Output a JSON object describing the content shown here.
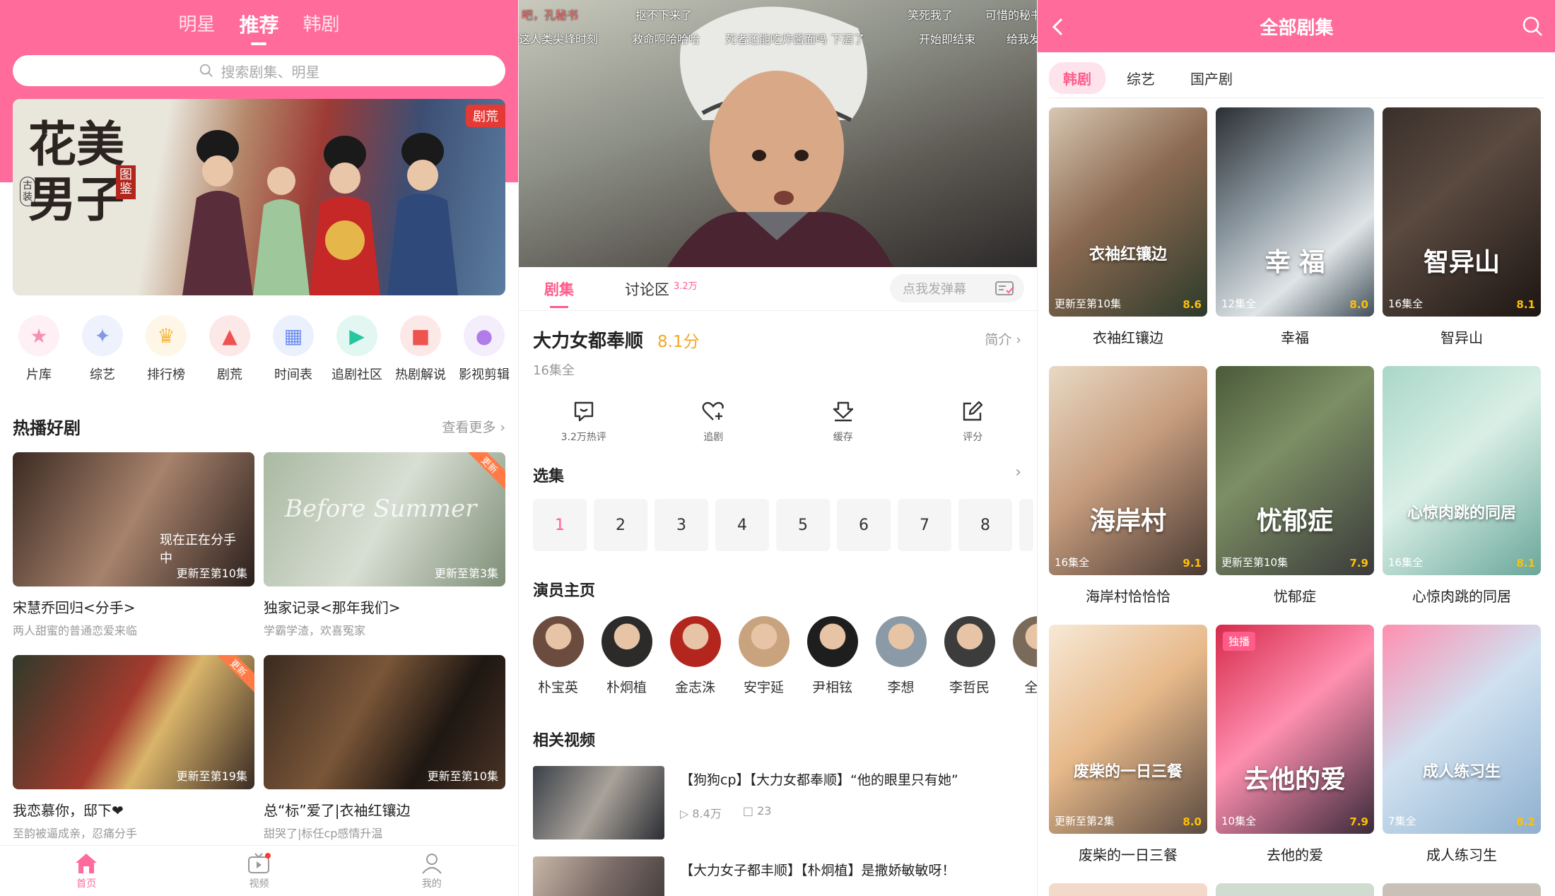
{
  "home": {
    "tabs": [
      "明星",
      "推荐",
      "韩剧"
    ],
    "active_tab": "推荐",
    "search_placeholder": "搜索剧集、明星",
    "banner": {
      "title": "花美男子",
      "tag_left": "古装",
      "tag_right": "图鉴",
      "badge": "剧荒"
    },
    "categories": [
      {
        "label": "片库",
        "icon": "library-icon",
        "color": "#f48fb1"
      },
      {
        "label": "综艺",
        "icon": "variety-icon",
        "color": "#7e9ce6"
      },
      {
        "label": "排行榜",
        "icon": "trophy-icon",
        "color": "#f5b942"
      },
      {
        "label": "剧荒",
        "icon": "fire-icon",
        "color": "#ef5350"
      },
      {
        "label": "时间表",
        "icon": "calendar-icon",
        "color": "#6c8ff0"
      },
      {
        "label": "追剧社区",
        "icon": "tv-icon",
        "color": "#26c6a0"
      },
      {
        "label": "热剧解说",
        "icon": "comment-icon",
        "color": "#ef5350"
      },
      {
        "label": "影视剪辑",
        "icon": "play-icon",
        "color": "#b07ce8"
      }
    ],
    "hot_section": {
      "title": "热播好剧",
      "more": "查看更多"
    },
    "hot_dramas": [
      {
        "title": "宋慧乔回归<分手>",
        "subtitle": "两人甜蜜的普通恋爱来临",
        "update": "更新至第10集",
        "corner": "",
        "overlay": "现在正在分手中"
      },
      {
        "title": "独家记录<那年我们>",
        "subtitle": "学霸学渣，欢喜冤家",
        "update": "更新至第3集",
        "corner": "更新",
        "overlay": "Before Summer"
      },
      {
        "title": "我恋慕你，邸下❤",
        "subtitle": "至韵被逼成亲，忍痛分手",
        "update": "更新至第19集",
        "corner": "更新",
        "overlay": ""
      },
      {
        "title": "总“标”爱了|衣袖红镶边",
        "subtitle": "甜哭了|标任cp感情升温",
        "update": "更新至第10集",
        "corner": "",
        "overlay": ""
      }
    ],
    "bottom_nav": [
      {
        "label": "首页",
        "icon": "home-icon",
        "active": true
      },
      {
        "label": "视频",
        "icon": "video-icon",
        "active": false
      },
      {
        "label": "我的",
        "icon": "profile-icon",
        "active": false
      }
    ]
  },
  "detail": {
    "danmaku": [
      "吧，孔秘书",
      "抠不下来了",
      "笑死我了",
      "可惜的秘书",
      "这人类尖峰时刻",
      "救命啊哈哈哈",
      "死者还能吃炸酱面吗 下酒了",
      "开始即结束",
      "给我发"
    ],
    "tabs": [
      {
        "label": "剧集",
        "sup": "",
        "active": true
      },
      {
        "label": "讨论区",
        "sup": "3.2万",
        "active": false
      }
    ],
    "danmaku_placeholder": "点我发弹幕",
    "title": "大力女都奉顺",
    "score": "8.1分",
    "intro": "简介",
    "episodes_info": "16集全",
    "actions": [
      {
        "label": "3.2万热评",
        "icon": "comment-icon"
      },
      {
        "label": "追剧",
        "icon": "heart-plus-icon"
      },
      {
        "label": "缓存",
        "icon": "download-icon"
      },
      {
        "label": "评分",
        "icon": "edit-icon"
      }
    ],
    "episode_section": "选集",
    "episodes": [
      "1",
      "2",
      "3",
      "4",
      "5",
      "6",
      "7",
      "8"
    ],
    "cast_section": "演员主页",
    "cast": [
      "朴宝英",
      "朴炯植",
      "金志洙",
      "安宇延",
      "尹相铉",
      "李想",
      "李哲民",
      "全钟"
    ],
    "related_section": "相关视频",
    "related": [
      {
        "title": "【狗狗cp】【大力女都奉顺】“他的眼里只有她”",
        "views": "8.4万",
        "comments": "23"
      },
      {
        "title": "【大力女子都丰顺】【朴炯植】是撒娇敏敏呀！",
        "views": "",
        "comments": ""
      }
    ]
  },
  "all_dramas": {
    "header_title": "全部剧集",
    "tabs": [
      "韩剧",
      "综艺",
      "国产剧"
    ],
    "active_tab": "韩剧",
    "items": [
      {
        "name": "衣袖红镶边",
        "episodes": "更新至第10集",
        "rating": "8.6",
        "exclusive": "",
        "art": "衣袖红镶边"
      },
      {
        "name": "幸福",
        "episodes": "12集全",
        "rating": "8.0",
        "exclusive": "",
        "art": "幸 福"
      },
      {
        "name": "智异山",
        "episodes": "16集全",
        "rating": "8.1",
        "exclusive": "",
        "art": "智异山"
      },
      {
        "name": "海岸村恰恰恰",
        "episodes": "16集全",
        "rating": "9.1",
        "exclusive": "",
        "art": "海岸村"
      },
      {
        "name": "忧郁症",
        "episodes": "更新至第10集",
        "rating": "7.9",
        "exclusive": "",
        "art": "忧郁症"
      },
      {
        "name": "心惊肉跳的同居",
        "episodes": "16集全",
        "rating": "8.1",
        "exclusive": "",
        "art": "心惊肉跳的同居"
      },
      {
        "name": "废柴的一日三餐",
        "episodes": "更新至第2集",
        "rating": "8.0",
        "exclusive": "",
        "art": "废柴的一日三餐"
      },
      {
        "name": "去他的爱",
        "episodes": "10集全",
        "rating": "7.9",
        "exclusive": "独播",
        "art": "去他的爱"
      },
      {
        "name": "成人练习生",
        "episodes": "7集全",
        "rating": "8.2",
        "exclusive": "",
        "art": "成人练习生"
      }
    ]
  },
  "colors": {
    "brand": "#ff6b9b",
    "accent": "#ff5c8a",
    "score": "#f5a623"
  }
}
